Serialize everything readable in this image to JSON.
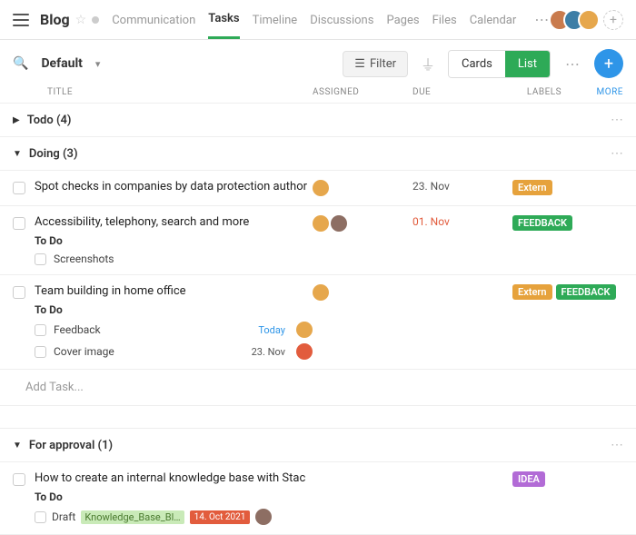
{
  "header": {
    "title": "Blog",
    "tabs": [
      "Communication",
      "Tasks",
      "Timeline",
      "Discussions",
      "Pages",
      "Files",
      "Calendar"
    ],
    "active_tab": "Tasks"
  },
  "toolbar": {
    "view_name": "Default",
    "filter_label": "Filter",
    "cards_label": "Cards",
    "list_label": "List"
  },
  "columns": {
    "title": "TITLE",
    "assigned": "ASSIGNED",
    "due": "DUE",
    "labels": "LABELS",
    "more": "MORE"
  },
  "groups": {
    "todo": {
      "name": "Todo (4)"
    },
    "doing": {
      "name": "Doing (3)"
    },
    "approval": {
      "name": "For approval (1)"
    }
  },
  "labels": {
    "extern": {
      "text": "Extern",
      "color": "#e6a23c"
    },
    "feedback": {
      "text": "FEEDBACK",
      "color": "#2eaa57"
    },
    "idea": {
      "text": "IDEA",
      "color": "#b26bd6"
    }
  },
  "tasks": {
    "doing": [
      {
        "title": "Spot checks in companies by data protection author",
        "due": "23. Nov",
        "overdue": false,
        "labels": [
          "extern"
        ],
        "assignees": 1
      },
      {
        "title": "Accessibility, telephony, search and more",
        "due": "01. Nov",
        "overdue": true,
        "labels": [
          "feedback"
        ],
        "assignees": 2,
        "subhdr": "To Do",
        "subtasks": [
          {
            "name": "Screenshots"
          }
        ]
      },
      {
        "title": "Team building in home office",
        "due": "",
        "labels": [
          "extern",
          "feedback"
        ],
        "assignees": 1,
        "subhdr": "To Do",
        "subtasks": [
          {
            "name": "Feedback",
            "due": "Today",
            "due_color": "blue",
            "av": "orange"
          },
          {
            "name": "Cover image",
            "due": "23. Nov",
            "due_color": "normal",
            "av": "red"
          }
        ]
      }
    ],
    "approval": [
      {
        "title": "How to create an internal knowledge base with Stac",
        "labels": [
          "idea"
        ],
        "subhdr": "To Do",
        "subtasks": [
          {
            "name": "Draft",
            "file": "Knowledge_Base_Bl…",
            "date_chip": "14. Oct 2021",
            "av": "brown"
          }
        ]
      }
    ]
  },
  "add_task": "Add Task..."
}
